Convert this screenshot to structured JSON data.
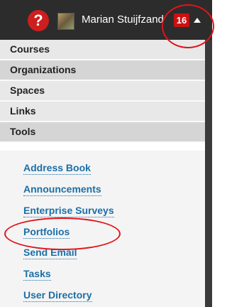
{
  "header": {
    "help_icon": "?",
    "user_name": "Marian Stuijfzand",
    "notification_count": "16",
    "menu_toggle_icon": "caret-up-icon"
  },
  "nav": {
    "items": [
      {
        "label": "Courses"
      },
      {
        "label": "Organizations"
      },
      {
        "label": "Spaces"
      },
      {
        "label": "Links"
      },
      {
        "label": "Tools"
      }
    ]
  },
  "tools": {
    "items": [
      {
        "label": "Address Book"
      },
      {
        "label": "Announcements"
      },
      {
        "label": "Enterprise Surveys"
      },
      {
        "label": "Portfolios"
      },
      {
        "label": "Send Email"
      },
      {
        "label": "Tasks"
      },
      {
        "label": "User Directory"
      }
    ]
  },
  "colors": {
    "topbar": "#2c2c2c",
    "help": "#cc1f1f",
    "badge": "#cc1010",
    "link": "#1c6fa6",
    "annotation": "#e0141a"
  }
}
